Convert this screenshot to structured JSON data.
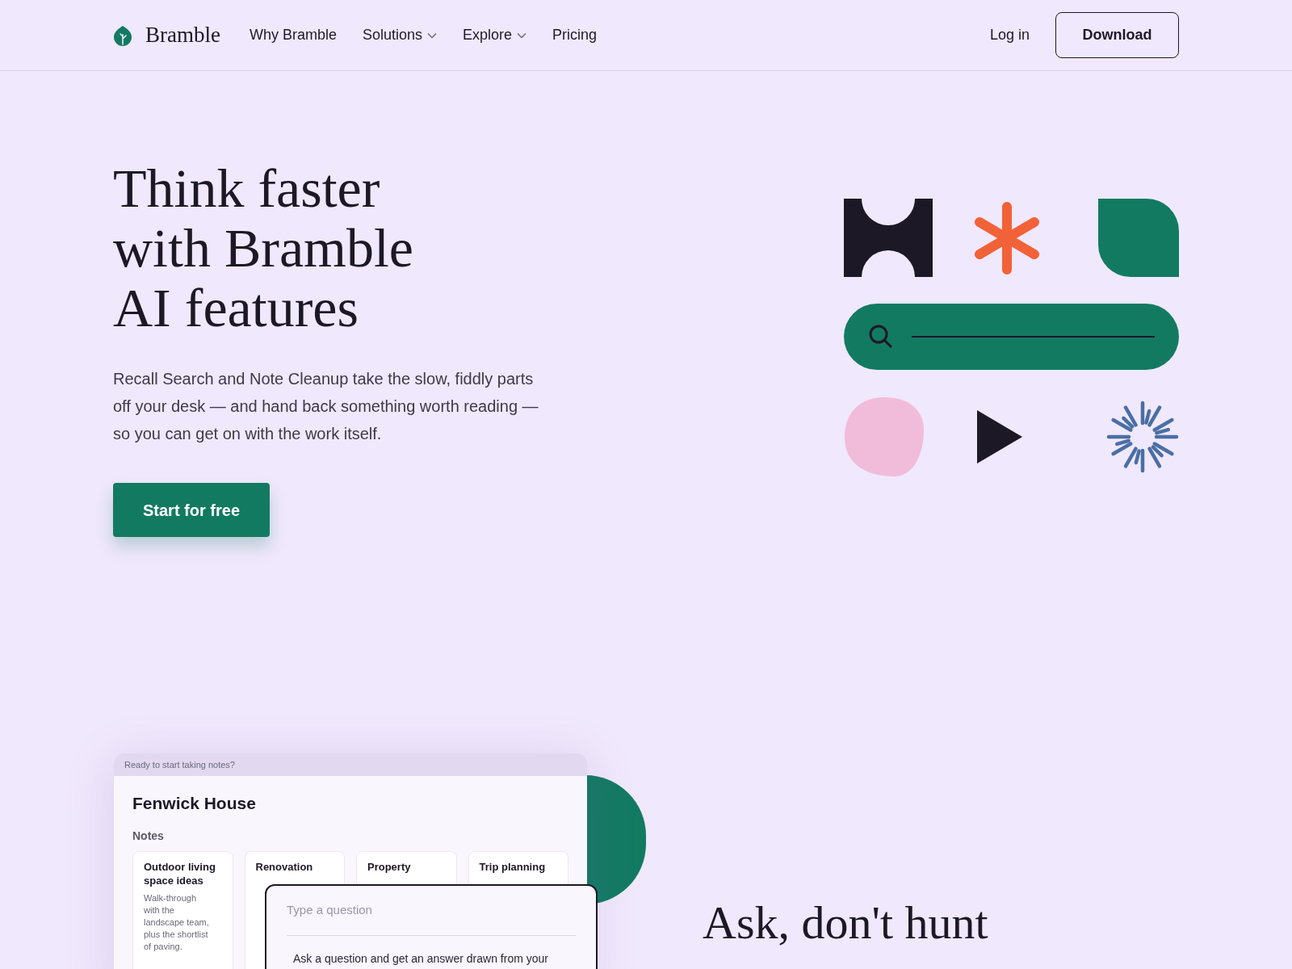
{
  "header": {
    "brand": "Bramble",
    "nav": [
      {
        "label": "Why Bramble",
        "dropdown": false
      },
      {
        "label": "Solutions",
        "dropdown": true
      },
      {
        "label": "Explore",
        "dropdown": true
      },
      {
        "label": "Pricing",
        "dropdown": false
      }
    ],
    "login": "Log in",
    "download": "Download"
  },
  "hero": {
    "title": "Think faster with Bramble AI features",
    "text": "Recall Search and Note Cleanup take the slow, fiddly parts off your desk — and hand back something worth reading — so you can get on with the work itself.",
    "cta": "Start for free"
  },
  "app_preview": {
    "banner": "Ready to start taking notes?",
    "title": "Fenwick House",
    "section": "Notes",
    "notes": [
      {
        "title_lines": [
          "Outdoor living",
          "space ideas"
        ],
        "body_lines": [
          "Walk-through",
          "with the",
          "landscape team,",
          "plus the shortlist",
          "of paving."
        ]
      },
      {
        "title_lines": [
          "Renovation"
        ]
      },
      {
        "title_lines": [
          "Property"
        ]
      },
      {
        "title_lines": [
          "Trip planning"
        ]
      }
    ],
    "question": {
      "placeholder": "Type a question",
      "answer": "Ask a question and get an answer drawn from your"
    }
  },
  "feature": {
    "heading": "Ask, don't hunt"
  }
}
